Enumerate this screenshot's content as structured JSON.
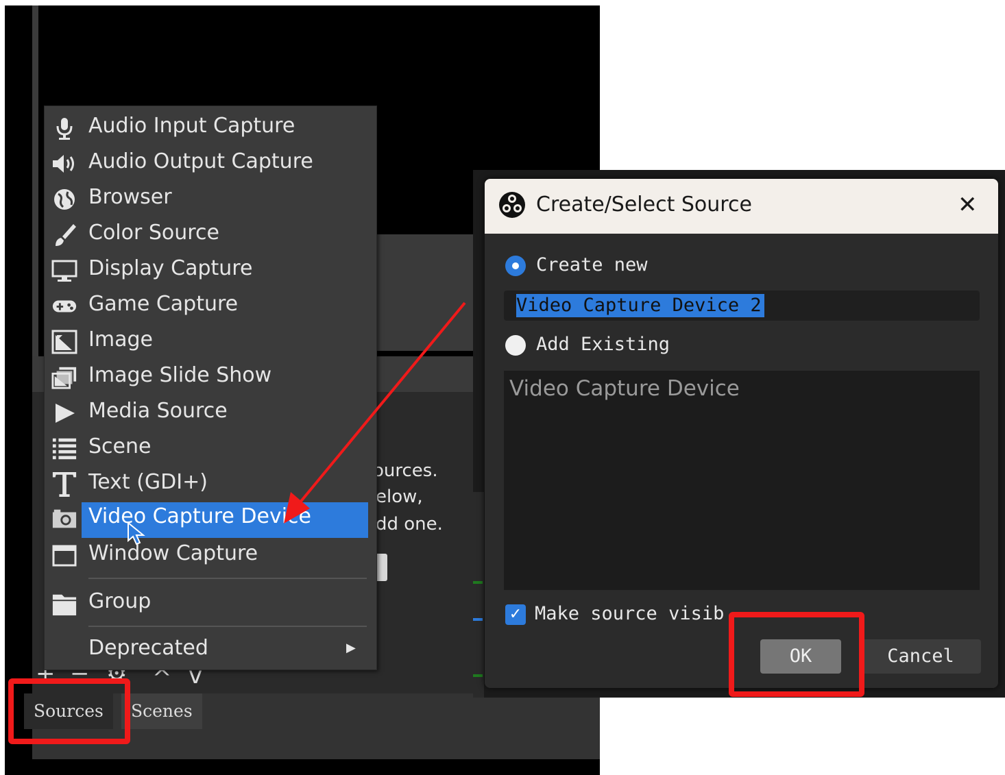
{
  "background_text": {
    "sources_hint_1": "ources.",
    "sources_hint_2": "elow,",
    "sources_hint_3": "dd one."
  },
  "dock": {
    "toolbar": [
      "+",
      "−",
      "⚙",
      "^",
      "v"
    ],
    "tabs": [
      "Sources",
      "Scenes"
    ]
  },
  "context_menu": {
    "items": [
      {
        "label": "Audio Input Capture",
        "icon": "microphone-icon"
      },
      {
        "label": "Audio Output Capture",
        "icon": "speaker-icon"
      },
      {
        "label": "Browser",
        "icon": "globe-icon"
      },
      {
        "label": "Color Source",
        "icon": "paintbrush-icon"
      },
      {
        "label": "Display Capture",
        "icon": "monitor-icon"
      },
      {
        "label": "Game Capture",
        "icon": "gamepad-icon"
      },
      {
        "label": "Image",
        "icon": "image-icon"
      },
      {
        "label": "Image Slide Show",
        "icon": "slideshow-icon"
      },
      {
        "label": "Media Source",
        "icon": "play-icon"
      },
      {
        "label": "Scene",
        "icon": "list-icon"
      },
      {
        "label": "Text (GDI+)",
        "icon": "text-icon"
      },
      {
        "label": "Video Capture Device",
        "icon": "camera-icon",
        "selected": true
      },
      {
        "label": "Window Capture",
        "icon": "window-icon"
      },
      {
        "label": "Group",
        "icon": "folder-icon"
      },
      {
        "label": "Deprecated",
        "icon": "",
        "has_submenu": true
      }
    ]
  },
  "dialog": {
    "title": "Create/Select Source",
    "create_new_label": "Create new",
    "name_value": "Video Capture Device 2",
    "add_existing_label": "Add Existing",
    "existing_items": [
      "Video Capture Device"
    ],
    "make_visible_label": "Make source visib",
    "ok_label": "OK",
    "cancel_label": "Cancel",
    "create_new_selected": true,
    "make_visible_checked": true
  },
  "colors": {
    "accent": "#2d7bdc",
    "annotation_red": "#f01a1a"
  }
}
